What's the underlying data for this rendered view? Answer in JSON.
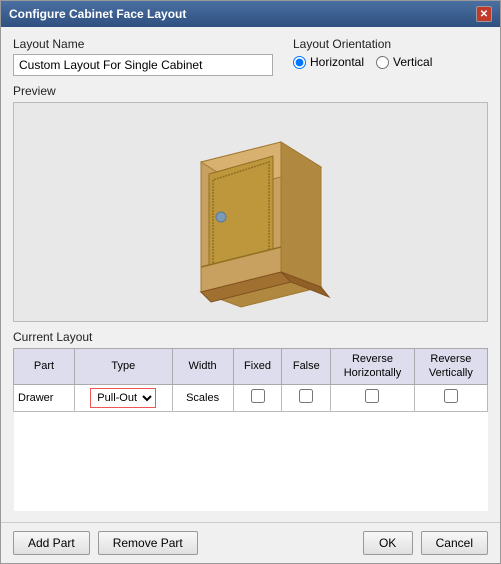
{
  "window": {
    "title": "Configure Cabinet Face Layout",
    "close_label": "✕"
  },
  "layout_name": {
    "label": "Layout Name",
    "value": "Custom Layout For Single Cabinet"
  },
  "layout_orientation": {
    "label": "Layout Orientation",
    "horizontal_label": "Horizontal",
    "vertical_label": "Vertical",
    "selected": "Horizontal"
  },
  "preview": {
    "label": "Preview"
  },
  "current_layout": {
    "label": "Current Layout",
    "columns": [
      "Part",
      "Type",
      "Width",
      "Fixed",
      "False",
      "Reverse\nHorizontally",
      "Reverse\nVertically"
    ],
    "col_part": "Part",
    "col_type": "Type",
    "col_width": "Width",
    "col_fixed": "Fixed",
    "col_false": "False",
    "col_rev_h": "Reverse Horizontally",
    "col_rev_v": "Reverse Vertically",
    "rows": [
      {
        "part": "Drawer",
        "type": "Pull-Out",
        "width": "Scales",
        "fixed": false,
        "false_val": false,
        "rev_h": false,
        "rev_v": false
      }
    ]
  },
  "buttons": {
    "add_part": "Add Part",
    "remove_part": "Remove Part",
    "ok": "OK",
    "cancel": "Cancel"
  }
}
